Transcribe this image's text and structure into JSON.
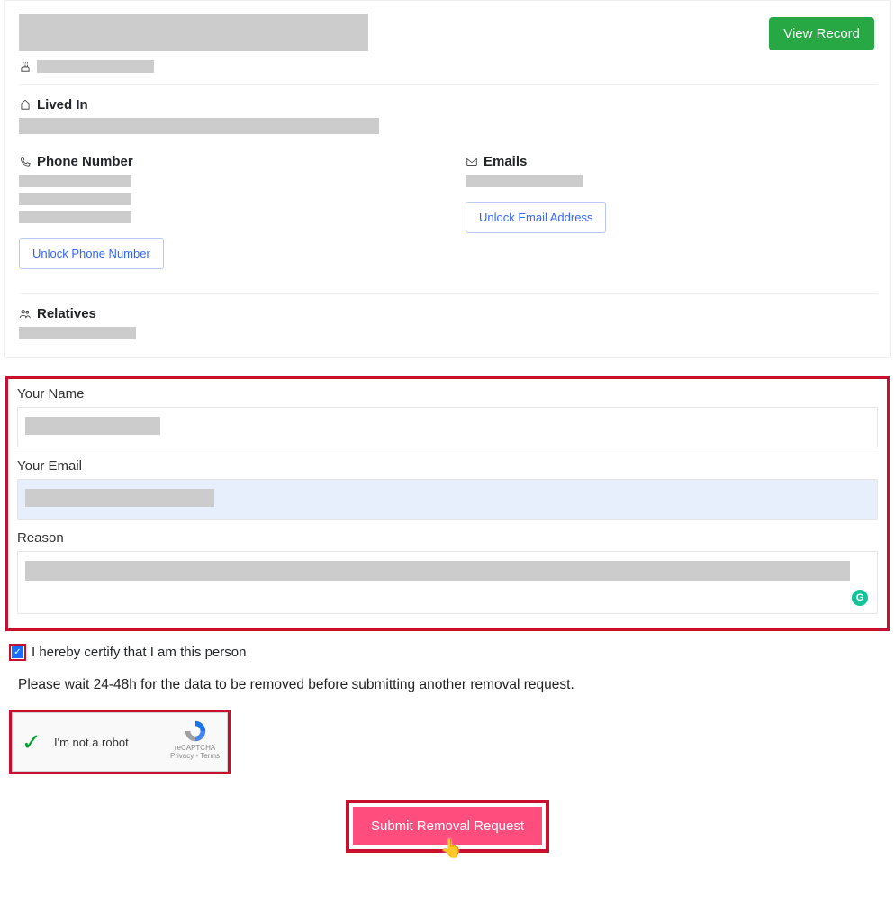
{
  "record": {
    "view_record_label": "View Record",
    "lived_in_heading": "Lived In",
    "phone_heading": "Phone Number",
    "emails_heading": "Emails",
    "relatives_heading": "Relatives",
    "unlock_phone_label": "Unlock Phone Number",
    "unlock_email_label": "Unlock Email Address"
  },
  "form": {
    "name_label": "Your Name",
    "email_label": "Your Email",
    "reason_label": "Reason",
    "certify_label": "I hereby certify that I am this person",
    "certify_checked": true,
    "wait_text": "Please wait 24-48h for the data to be removed before submitting another removal request.",
    "submit_label": "Submit Removal Request"
  },
  "captcha": {
    "label": "I'm not a robot",
    "brand": "reCAPTCHA",
    "legal": "Privacy - Terms",
    "checked": true
  },
  "icons": {
    "cake": "cake-icon",
    "home": "home-icon",
    "phone": "phone-icon",
    "mail": "mail-icon",
    "people": "people-icon",
    "grammarly_glyph": "G",
    "cursor": "👆"
  }
}
